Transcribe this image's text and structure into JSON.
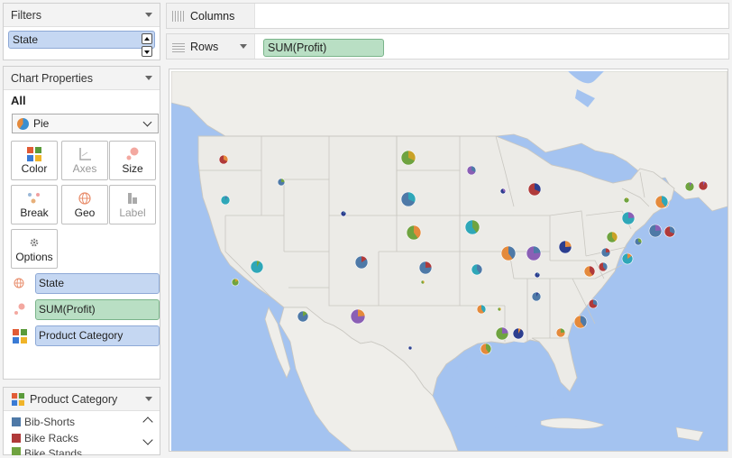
{
  "filters": {
    "title": "Filters",
    "items": [
      "State"
    ]
  },
  "chart_properties": {
    "title": "Chart Properties",
    "all_label": "All",
    "mark_type": "Pie",
    "buttons": [
      {
        "label": "Color",
        "icon": "color-squares-icon",
        "enabled": true
      },
      {
        "label": "Axes",
        "icon": "axes-icon",
        "enabled": false
      },
      {
        "label": "Size",
        "icon": "size-dots-icon",
        "enabled": true
      },
      {
        "label": "Break",
        "icon": "break-icon",
        "enabled": true
      },
      {
        "label": "Geo",
        "icon": "globe-icon",
        "enabled": true
      },
      {
        "label": "Label",
        "icon": "label-bars-icon",
        "enabled": false
      },
      {
        "label": "Options",
        "icon": "gear-icon",
        "enabled": true
      }
    ],
    "encodings": [
      {
        "icon": "globe-icon",
        "field": "State",
        "color": "blue"
      },
      {
        "icon": "size-dots-icon",
        "field": "SUM(Profit)",
        "color": "green"
      },
      {
        "icon": "color-squares-icon",
        "field": "Product Category",
        "color": "blue"
      }
    ]
  },
  "legend": {
    "title": "Product Category",
    "items": [
      {
        "label": "Bib-Shorts",
        "color": "#4e79a7"
      },
      {
        "label": "Bike Racks",
        "color": "#b03a3a"
      },
      {
        "label": "Bike Stands",
        "color": "#6fa340"
      }
    ]
  },
  "columns_shelf": {
    "label": "Columns"
  },
  "rows_shelf": {
    "label": "Rows",
    "pill": "SUM(Profit)"
  },
  "colors": {
    "water": "#a4c3f0",
    "land": "#efeeea",
    "us_land": "#ecebe7",
    "border": "#c9c7c1",
    "pill_blue": "#c5d7f2",
    "pill_green": "#b9dfc4"
  }
}
